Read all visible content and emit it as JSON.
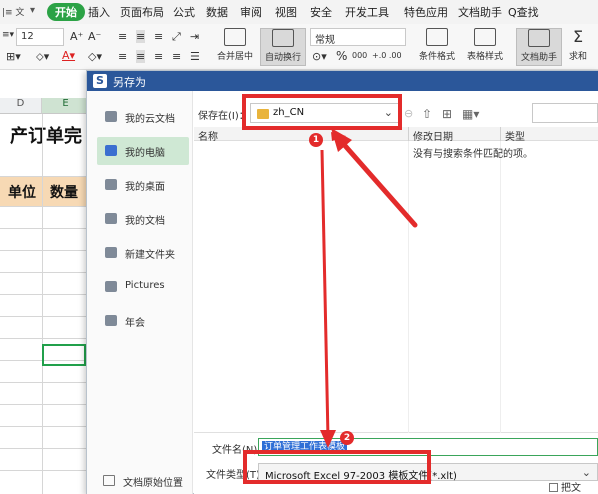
{
  "menu": {
    "left_frag": "|≡ 文",
    "start": "开始",
    "items": [
      "插入",
      "页面布局",
      "公式",
      "数据",
      "审阅",
      "视图",
      "安全",
      "开发工具",
      "特色应用",
      "文档助手"
    ],
    "search": "Q查找"
  },
  "toolbar": {
    "font_size": "12",
    "number_format": "常规",
    "merge_label": "合并居中",
    "wrap_label": "自动换行",
    "cond_format_label": "条件格式",
    "table_style_label": "表格样式",
    "doc_helper_label": "文档助手",
    "sum_label": "求和",
    "percent": "%",
    "thousands": "000",
    "inc_dec": "+.0  .00"
  },
  "sheet": {
    "columns": [
      "D",
      "E"
    ],
    "title_fragment": "产订单完",
    "header_cells": [
      "单位",
      "数量"
    ],
    "header_color": "#f7d9b4"
  },
  "dialog": {
    "title": "另存为",
    "title_bar_color": "#2b579a",
    "sidebar": {
      "items": [
        {
          "label": "我的云文档",
          "icon": "cloud-doc-icon"
        },
        {
          "label": "我的电脑",
          "icon": "computer-icon"
        },
        {
          "label": "我的桌面",
          "icon": "desktop-icon"
        },
        {
          "label": "我的文档",
          "icon": "folder-icon"
        },
        {
          "label": "新建文件夹",
          "icon": "folder-icon"
        },
        {
          "label": "Pictures",
          "icon": "folder-icon"
        },
        {
          "label": "年会",
          "icon": "folder-icon"
        }
      ],
      "active_index": 1,
      "bottom_label": "文档原始位置"
    },
    "save_in_label": "保存在(I)：",
    "save_in_value": "zh_CN",
    "columns": [
      "名称",
      "修改日期",
      "类型"
    ],
    "empty_message": "没有与搜索条件匹配的项。",
    "filename_label": "文件名(N)：",
    "filename_value": "订单管理工作表模板",
    "filetype_label": "文件类型(T)：",
    "filetype_value": "Microsoft Excel 97-2003 模板文件(*.xlt)",
    "checkbox_fragment": "把文"
  },
  "annotations": {
    "badge1": "1",
    "badge2": "2",
    "color": "#e32b2b"
  }
}
